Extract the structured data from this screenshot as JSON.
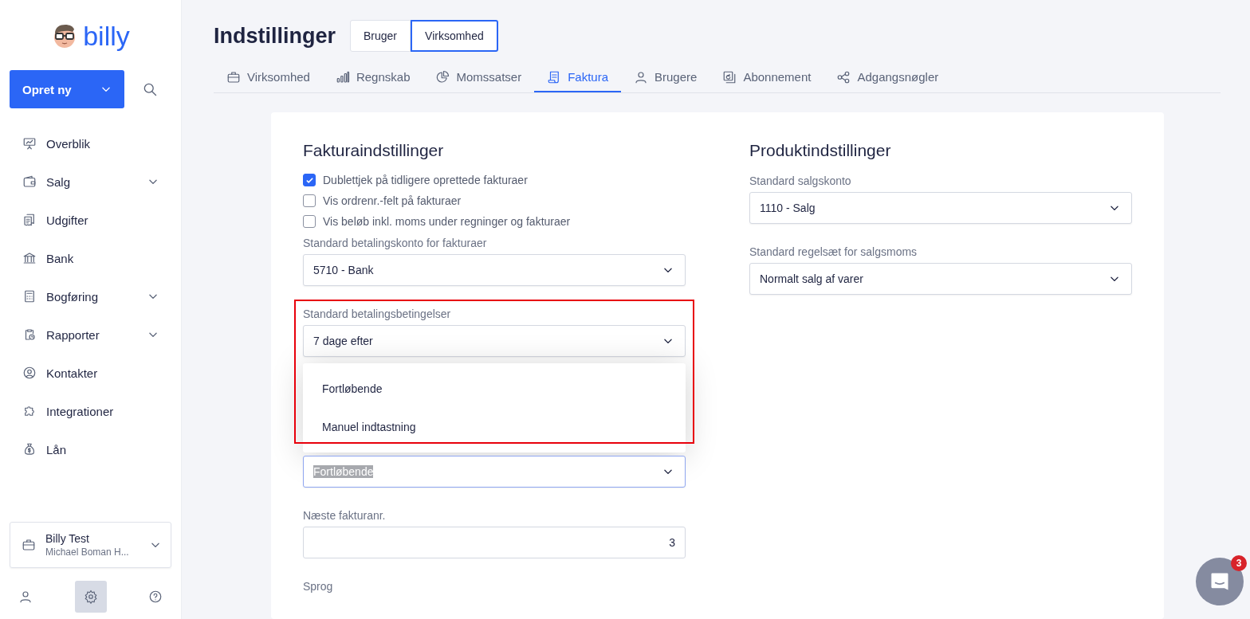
{
  "logo": {
    "text": "billy"
  },
  "create_button": {
    "label": "Opret ny"
  },
  "sidebar": {
    "items": [
      {
        "label": "Overblik",
        "expandable": false
      },
      {
        "label": "Salg",
        "expandable": true
      },
      {
        "label": "Udgifter",
        "expandable": false
      },
      {
        "label": "Bank",
        "expandable": false
      },
      {
        "label": "Bogføring",
        "expandable": true
      },
      {
        "label": "Rapporter",
        "expandable": true
      },
      {
        "label": "Kontakter",
        "expandable": false
      },
      {
        "label": "Integrationer",
        "expandable": false
      },
      {
        "label": "Lån",
        "expandable": false
      }
    ]
  },
  "company": {
    "name": "Billy Test",
    "user": "Michael Boman H..."
  },
  "bottom_nav": [
    {
      "selected": false
    },
    {
      "selected": true
    },
    {
      "selected": false
    }
  ],
  "page_title": "Indstillinger",
  "scope": [
    {
      "label": "Bruger",
      "selected": false
    },
    {
      "label": "Virksomhed",
      "selected": true
    }
  ],
  "tabs": [
    {
      "label": "Virksomhed",
      "selected": false
    },
    {
      "label": "Regnskab",
      "selected": false
    },
    {
      "label": "Momssatser",
      "selected": false
    },
    {
      "label": "Faktura",
      "selected": true
    },
    {
      "label": "Brugere",
      "selected": false
    },
    {
      "label": "Abonnement",
      "selected": false
    },
    {
      "label": "Adgangsnøgler",
      "selected": false
    }
  ],
  "invoice_settings": {
    "title": "Fakturaindstillinger",
    "fields": [
      {
        "kind": "checkbox",
        "label": "Dublettjek på tidligere oprettede fakturaer",
        "checked": true
      },
      {
        "kind": "checkbox",
        "label": "Vis ordrenr.-felt på fakturaer",
        "checked": false
      },
      {
        "kind": "checkbox",
        "label": "Vis beløb inkl. moms under regninger og fakturaer",
        "checked": false
      },
      {
        "kind": "select",
        "label": "Standard betalingskonto for fakturaer",
        "value": "5710 - Bank"
      },
      {
        "kind": "select",
        "label": "Standard betalingsbetingelser",
        "value": "7 dage efter",
        "annotated": true,
        "menu_options": [
          {
            "label": "Fortløbende"
          },
          {
            "label": "Manuel indtastning"
          }
        ]
      },
      {
        "kind": "select",
        "value": "Fortløbende",
        "focused": true
      },
      {
        "kind": "input",
        "label": "Næste fakturanr.",
        "value": "3"
      },
      {
        "kind": "label",
        "label": "Sprog"
      }
    ]
  },
  "product_settings": {
    "title": "Produktindstillinger",
    "fields": [
      {
        "kind": "select",
        "label": "Standard salgskonto",
        "value": "1110 - Salg"
      },
      {
        "kind": "select",
        "label": "Standard regelsæt for salgsmoms",
        "value": "Normalt salg af varer"
      }
    ]
  },
  "chat": {
    "badge": "3"
  }
}
